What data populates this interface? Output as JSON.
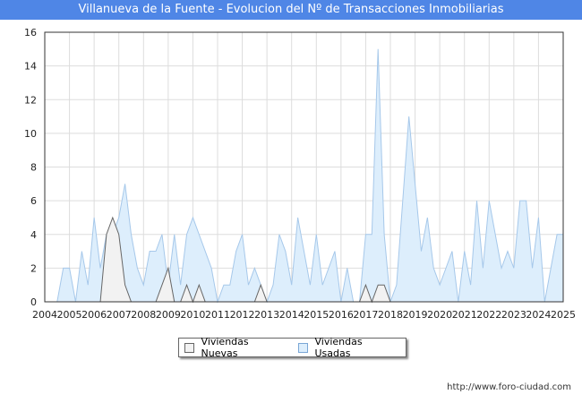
{
  "chart_data": {
    "type": "area",
    "title": "Villanueva de la Fuente - Evolucion del Nº de Transacciones Inmobiliarias",
    "xlabel": "",
    "ylabel": "",
    "x_tick_labels": [
      "2004",
      "2005",
      "2006",
      "2007",
      "2008",
      "2009",
      "2010",
      "2011",
      "2012",
      "2013",
      "2014",
      "2015",
      "2016",
      "2017",
      "2018",
      "2019",
      "2020",
      "2021",
      "2022",
      "2023",
      "2024",
      "2025"
    ],
    "y_tick_labels": [
      "0",
      "2",
      "4",
      "6",
      "8",
      "10",
      "12",
      "14",
      "16"
    ],
    "xlim": [
      2004,
      2025
    ],
    "ylim": [
      0,
      16
    ],
    "grid": true,
    "legend_position": "bottom-center",
    "series": [
      {
        "name": "Viviendas Nuevas",
        "color": "#666666",
        "fill": "#f2f2f2",
        "x": [
          2004.5,
          2004.75,
          2005,
          2005.25,
          2005.5,
          2005.75,
          2006,
          2006.25,
          2006.5,
          2006.75,
          2007,
          2007.25,
          2007.5,
          2007.75,
          2008,
          2008.25,
          2008.5,
          2008.75,
          2009,
          2009.25,
          2009.5,
          2009.75,
          2010,
          2010.25,
          2010.5,
          2010.75,
          2011,
          2011.25,
          2011.5,
          2011.75,
          2012,
          2012.25,
          2012.5,
          2012.75,
          2013,
          2013.25,
          2013.5,
          2013.75,
          2014,
          2014.25,
          2014.5,
          2014.75,
          2015,
          2015.25,
          2015.5,
          2015.75,
          2016,
          2016.25,
          2016.5,
          2016.75,
          2017,
          2017.25,
          2017.5,
          2017.75,
          2018,
          2018.25,
          2018.5,
          2018.75,
          2019,
          2019.25,
          2019.5,
          2019.75,
          2020,
          2020.25,
          2020.5,
          2020.75,
          2021,
          2021.25,
          2021.5,
          2021.75,
          2022,
          2022.25,
          2022.5,
          2022.75,
          2023,
          2023.25,
          2023.5,
          2023.75,
          2024,
          2024.25,
          2024.5,
          2024.75,
          2025
        ],
        "values": [
          0,
          0,
          0,
          0,
          0,
          0,
          0,
          0,
          4,
          5,
          4,
          1,
          0,
          0,
          0,
          0,
          0,
          1,
          2,
          0,
          0,
          1,
          0,
          1,
          0,
          0,
          0,
          0,
          0,
          0,
          0,
          0,
          0,
          1,
          0,
          0,
          0,
          0,
          0,
          0,
          0,
          0,
          0,
          0,
          0,
          0,
          0,
          0,
          0,
          0,
          1,
          0,
          1,
          1,
          0,
          0,
          0,
          0,
          0,
          0,
          0,
          0,
          0,
          0,
          0,
          0,
          0,
          0,
          0,
          0,
          0,
          0,
          0,
          0,
          0,
          0,
          0,
          0,
          0,
          0,
          0,
          0,
          0
        ]
      },
      {
        "name": "Viviendas Usadas",
        "color": "#a6c8ea",
        "fill": "#ddeefc",
        "x": [
          2004.5,
          2004.75,
          2005,
          2005.25,
          2005.5,
          2005.75,
          2006,
          2006.25,
          2006.5,
          2006.75,
          2007,
          2007.25,
          2007.5,
          2007.75,
          2008,
          2008.25,
          2008.5,
          2008.75,
          2009,
          2009.25,
          2009.5,
          2009.75,
          2010,
          2010.25,
          2010.5,
          2010.75,
          2011,
          2011.25,
          2011.5,
          2011.75,
          2012,
          2012.25,
          2012.5,
          2012.75,
          2013,
          2013.25,
          2013.5,
          2013.75,
          2014,
          2014.25,
          2014.5,
          2014.75,
          2015,
          2015.25,
          2015.5,
          2015.75,
          2016,
          2016.25,
          2016.5,
          2016.75,
          2017,
          2017.25,
          2017.5,
          2017.75,
          2018,
          2018.25,
          2018.5,
          2018.75,
          2019,
          2019.25,
          2019.5,
          2019.75,
          2020,
          2020.25,
          2020.5,
          2020.75,
          2021,
          2021.25,
          2021.5,
          2021.75,
          2022,
          2022.25,
          2022.5,
          2022.75,
          2023,
          2023.25,
          2023.5,
          2023.75,
          2024,
          2024.25,
          2024.5,
          2024.75,
          2025
        ],
        "values": [
          0,
          2,
          2,
          0,
          3,
          1,
          5,
          2,
          4,
          4,
          5,
          7,
          4,
          2,
          1,
          3,
          3,
          4,
          1,
          4,
          1,
          4,
          5,
          4,
          3,
          2,
          0,
          1,
          1,
          3,
          4,
          1,
          2,
          1,
          0,
          1,
          4,
          3,
          1,
          5,
          3,
          1,
          4,
          1,
          2,
          3,
          0,
          2,
          0,
          0,
          4,
          4,
          15,
          4,
          0,
          1,
          6,
          11,
          7,
          3,
          5,
          2,
          1,
          2,
          3,
          0,
          3,
          1,
          6,
          2,
          6,
          4,
          2,
          3,
          2,
          6,
          6,
          2,
          5,
          0,
          2,
          4,
          4
        ]
      }
    ]
  },
  "footer": {
    "source": "http://www.foro-ciudad.com"
  }
}
